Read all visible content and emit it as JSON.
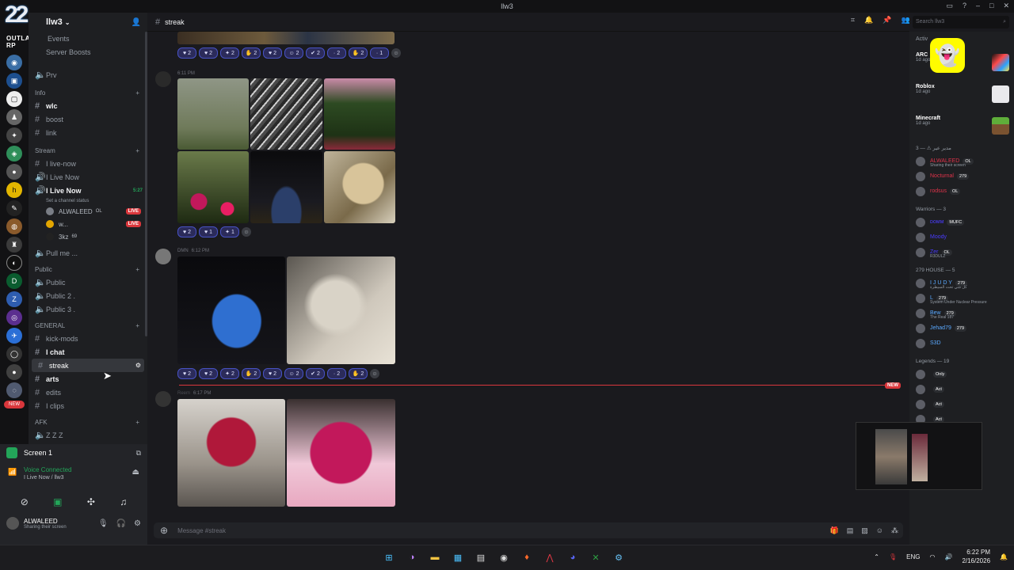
{
  "window": {
    "title": "llw3",
    "back": "←"
  },
  "server": {
    "name": "llw3",
    "logo_text": "22",
    "logo_sub": "OUTLAW RP"
  },
  "channels": {
    "top": [
      {
        "label": "Events",
        "icon": "calendar-icon"
      },
      {
        "label": "Server Boosts",
        "icon": "boost-icon"
      }
    ],
    "prv": "Prv",
    "info_cat": "Info",
    "info": [
      "wlc",
      "boost",
      "link"
    ],
    "stream_cat": "Stream",
    "stream": [
      "I live-now",
      "I Live Now",
      "I Live Now"
    ],
    "stream_time": "5:27",
    "set_status": "Set a channel status",
    "voice_users": [
      {
        "name": "ALWALEED",
        "tag": "OL",
        "live": "LIVE"
      },
      {
        "name": "w...",
        "tag": "",
        "live": "LIVE"
      },
      {
        "name": "3kz",
        "tag": "69",
        "live": ""
      }
    ],
    "pull": "Pull me ...",
    "public_cat": "Public",
    "public": [
      "Public",
      "Public 2 .",
      "Public 3 ."
    ],
    "general_cat": "GENERAL",
    "general": [
      "kick-mods",
      "I chat",
      "streak",
      "arts",
      "edits",
      "I clips"
    ],
    "afk_cat": "AFK",
    "afk": "Z Z Z"
  },
  "panel": {
    "screen": "Screen 1",
    "voice": "Voice Connected",
    "voice_sub": "I Live Now / llw3",
    "user": "ALWALEED",
    "user_status": "Sharing their screen"
  },
  "chat": {
    "channel": "streak",
    "messages": [
      {
        "time": "6:11 PM"
      },
      {
        "author": "DMN",
        "time": "6:12 PM"
      },
      {
        "author": "Reem",
        "time": "6:17 PM"
      }
    ],
    "reactions1": [
      "2",
      "2",
      "2",
      "2",
      "2",
      "2",
      "2",
      "2",
      "2",
      "1"
    ],
    "reactions2": [
      "2",
      "1",
      "1"
    ],
    "reactions3": [
      "2",
      "2",
      "2",
      "2",
      "2",
      "2",
      "2",
      "2",
      "2"
    ],
    "new_label": "NEW",
    "placeholder": "Message #streak"
  },
  "header": {
    "search": "Search llw3"
  },
  "members": {
    "activity_title": "Activ",
    "activities": [
      {
        "title": "ARC",
        "ago": "1d ago",
        "badge": "ARC Raiders"
      },
      {
        "title": "Roblox",
        "ago": "1d ago"
      },
      {
        "title": "Minecraft",
        "ago": "1d ago"
      }
    ],
    "group1": "مدير عير ⚠ — 3",
    "group1_members": [
      {
        "name": "ALWALEED",
        "color": "#e0334a",
        "badge": "OL",
        "sub": "Sharing their screen"
      },
      {
        "name": "Nocturnal",
        "color": "#e0334a",
        "badge": "279",
        "sub": ""
      },
      {
        "name": "rodsus",
        "color": "#e0334a",
        "badge": "OL",
        "sub": ""
      }
    ],
    "group2": "Warriors — 3",
    "group2_members": [
      {
        "name": "ᴅᴏᴍᴍ",
        "color": "#4a3cff",
        "badge": "MUFC",
        "sub": ""
      },
      {
        "name": "Moody",
        "color": "#4a3cff",
        "badge": "",
        "sub": ""
      },
      {
        "name": "Zer",
        "color": "#4a3cff",
        "badge": "OL",
        "sub": "R3DULZ"
      }
    ],
    "group3": "279 HOUSE — 5",
    "group3_members": [
      {
        "name": "I J U D Y",
        "color": "#5aa9ff",
        "badge": "279",
        "sub": "كل شي تحت السيطرة"
      },
      {
        "name": "L",
        "color": "#5aa9ff",
        "badge": "279",
        "sub": "System Under Nuclear Pressure"
      },
      {
        "name": "Bew",
        "color": "#5aa9ff",
        "badge": "279",
        "sub": "The Real 187"
      },
      {
        "name": "Jehad79",
        "color": "#5aa9ff",
        "badge": "279",
        "sub": ""
      },
      {
        "name": "S3D",
        "color": "#5aa9ff",
        "badge": "",
        "sub": ""
      }
    ],
    "group4": "Legends — 19",
    "group4_members": [
      {
        "name": "",
        "color": "#fff",
        "badge": "Only",
        "sub": ""
      },
      {
        "name": "",
        "color": "#fff",
        "badge": "Act",
        "sub": ""
      },
      {
        "name": "",
        "color": "#fff",
        "badge": "Act",
        "sub": ""
      },
      {
        "name": "",
        "color": "#fff",
        "badge": "Act",
        "sub": ""
      }
    ]
  },
  "taskbar": {
    "lang": "ENG",
    "time": "6:22 PM",
    "date": "2/16/2026"
  },
  "colors": {
    "accent": "#5865f2",
    "green": "#23a559",
    "red": "#da373c",
    "bg": "#1a1a1e"
  }
}
